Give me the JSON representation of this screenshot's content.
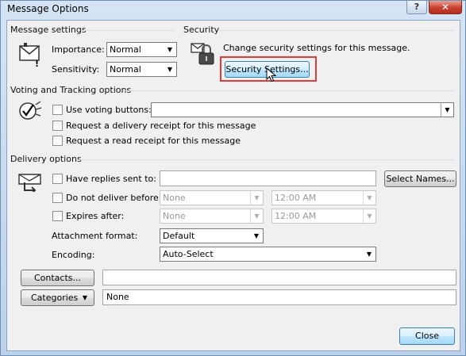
{
  "window": {
    "title": "Message Options",
    "help_label": "?",
    "close_label": "✕"
  },
  "message_settings": {
    "group_title": "Message settings",
    "importance_label": "Importance:",
    "importance_value": "Normal",
    "sensitivity_label": "Sensitivity:",
    "sensitivity_value": "Normal"
  },
  "security": {
    "group_title": "Security",
    "description": "Change security settings for this message.",
    "button_label": "Security Settings..."
  },
  "voting": {
    "group_title": "Voting and Tracking options",
    "use_voting_label": "Use voting buttons:",
    "use_voting_value": "",
    "delivery_receipt_label": "Request a delivery receipt for this message",
    "read_receipt_label": "Request a read receipt for this message"
  },
  "delivery": {
    "group_title": "Delivery options",
    "replies_label": "Have replies sent to:",
    "replies_value": "",
    "select_names_label": "Select Names...",
    "do_not_deliver_label": "Do not deliver before:",
    "do_not_deliver_date": "None",
    "do_not_deliver_time": "12:00 AM",
    "expires_label": "Expires after:",
    "expires_date": "None",
    "expires_time": "12:00 AM",
    "attachment_label": "Attachment format:",
    "attachment_value": "Default",
    "encoding_label": "Encoding:",
    "encoding_value": "Auto-Select"
  },
  "contacts": {
    "button_label": "Contacts...",
    "value": ""
  },
  "categories": {
    "button_label": "Categories",
    "value": "None"
  },
  "footer": {
    "close_label": "Close"
  }
}
